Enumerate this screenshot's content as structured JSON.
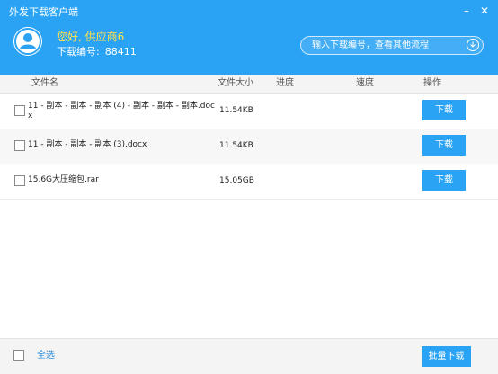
{
  "window": {
    "title": "外发下载客户端",
    "minimize_glyph": "–",
    "close_glyph": "✕"
  },
  "header": {
    "greeting": "您好, 供应商6",
    "order_label": "下载编号:",
    "order_number": "88411",
    "search_placeholder": "输入下载编号，查看其他流程",
    "search_icon": "download-circle-icon",
    "accent_color": "#2aa3f5",
    "greeting_color": "#ffe14a"
  },
  "table": {
    "columns": [
      "文件名",
      "文件大小",
      "进度",
      "速度",
      "操作"
    ],
    "rows": [
      {
        "name": "11 - 副本 - 副本 - 副本 (4) - 副本 - 副本 - 副本.docx",
        "size": "11.54KB",
        "action": "下载"
      },
      {
        "name": "11 - 副本 - 副本 - 副本 (3).docx",
        "size": "11.54KB",
        "action": "下载"
      },
      {
        "name": "15.6G大压缩包.rar",
        "size": "15.05GB",
        "action": "下载"
      }
    ]
  },
  "footer": {
    "select_all": "全选",
    "batch_download": "批量下载"
  }
}
